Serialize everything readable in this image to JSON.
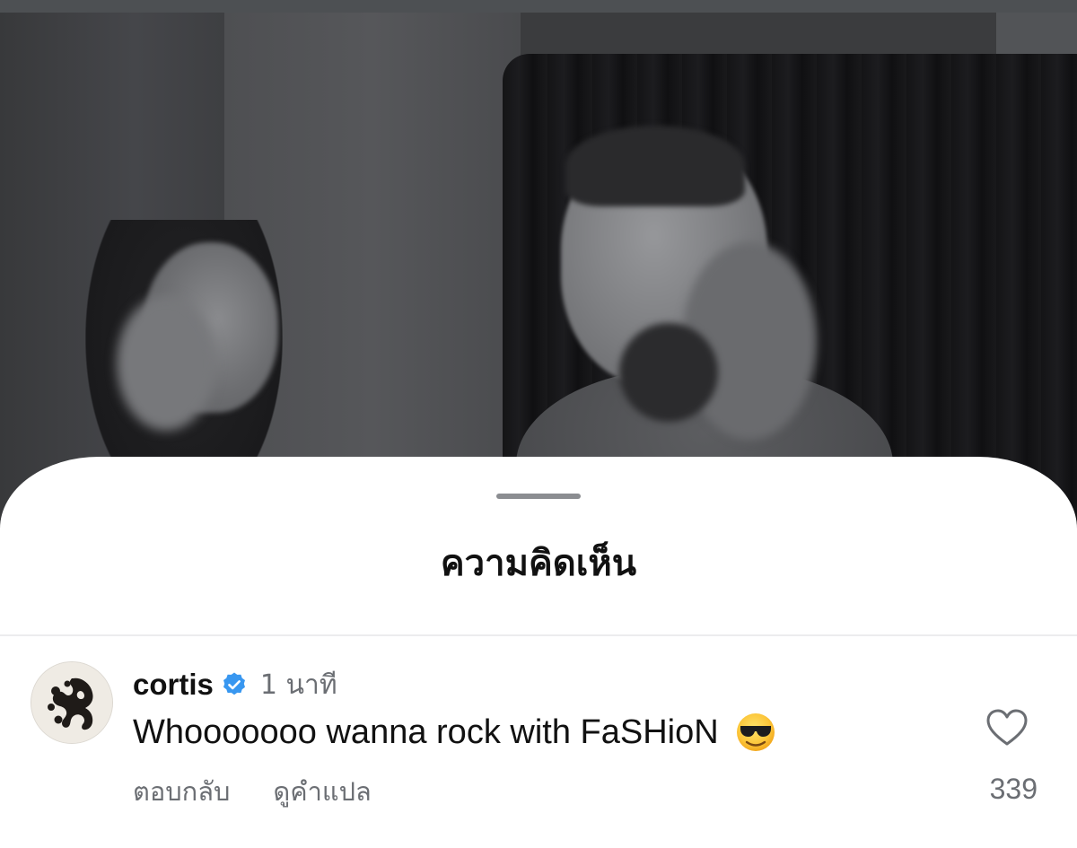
{
  "sheet": {
    "title": "ความคิดเห็น"
  },
  "comment": {
    "username": "cortis",
    "verified": true,
    "timestamp": "1 นาที",
    "text": "Whooooooo wanna rock with FaSHioN",
    "emoji": "smiling-face-with-sunglasses",
    "actions": {
      "reply": "ตอบกลับ",
      "translate": "ดูคำแปล"
    },
    "like_count": "339"
  },
  "colors": {
    "verified_badge": "#3897f0",
    "secondary_text": "#6b6e73",
    "primary_text": "#111111"
  }
}
